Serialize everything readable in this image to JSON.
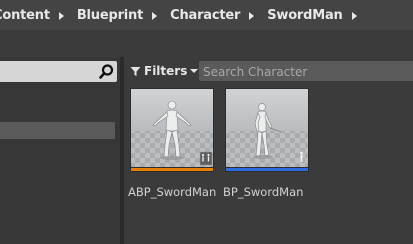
{
  "breadcrumb": {
    "items": [
      "Content",
      "Blueprint",
      "Character",
      "SwordMan"
    ]
  },
  "sources_panel": {
    "search_value": ""
  },
  "toolbar": {
    "filters_label": "Filters",
    "search_placeholder": "Search Character"
  },
  "assets": [
    {
      "name": "ABP_SwordMan",
      "type_color": "#e67e00",
      "type_icon": "animation-blueprint-icon"
    },
    {
      "name": "BP_SwordMan",
      "type_color": "#2e6ae0",
      "type_icon": "character-blueprint-icon"
    }
  ]
}
